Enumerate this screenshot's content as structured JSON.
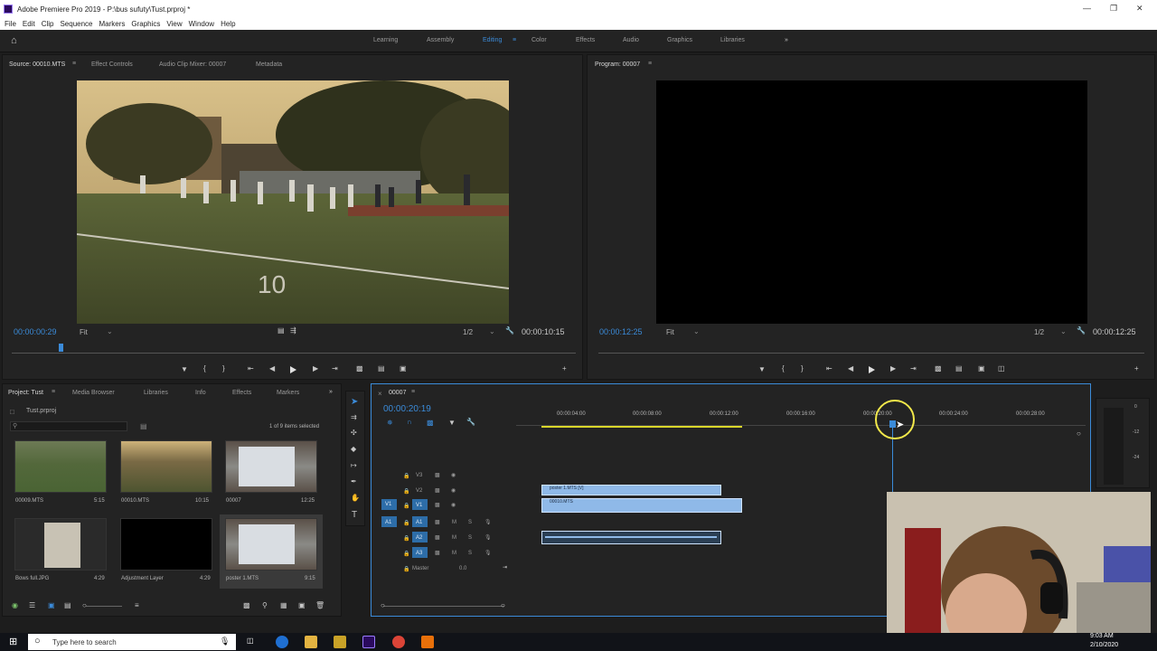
{
  "titlebar": {
    "title": "Adobe Premiere Pro 2019 - P:\\bus sufuty\\Tust.prproj *"
  },
  "menu": [
    "File",
    "Edit",
    "Clip",
    "Sequence",
    "Markers",
    "Graphics",
    "View",
    "Window",
    "Help"
  ],
  "workspaces": [
    "Learning",
    "Assembly",
    "Editing",
    "Color",
    "Effects",
    "Audio",
    "Graphics",
    "Libraries"
  ],
  "active_workspace": "Editing",
  "source": {
    "tabs": [
      "Source: 00010.MTS",
      "Effect Controls",
      "Audio Clip Mixer: 00007",
      "Metadata"
    ],
    "timecode": "00:00:00:29",
    "fit": "Fit",
    "resolution": "1/2",
    "duration": "00:00:10:15"
  },
  "program": {
    "tab": "Program: 00007",
    "timecode": "00:00:12:25",
    "fit": "Fit",
    "resolution": "1/2",
    "duration": "00:00:12:25"
  },
  "project": {
    "tabs": [
      "Project: Tust",
      "Media Browser",
      "Libraries",
      "Info",
      "Effects",
      "Markers"
    ],
    "file": "Tust.prproj",
    "selection": "1 of 9 items selected",
    "items": [
      {
        "name": "00009.MTS",
        "duration": "5:15"
      },
      {
        "name": "00010.MTS",
        "duration": "10:15"
      },
      {
        "name": "00007",
        "duration": "12:25"
      },
      {
        "name": "Bows full.JPG",
        "duration": "4:29"
      },
      {
        "name": "Adjustment Layer",
        "duration": "4:29"
      },
      {
        "name": "poster 1.MTS",
        "duration": "9:15"
      }
    ]
  },
  "timeline": {
    "tab": "00007",
    "timecode": "00:00:20:19",
    "ruler": [
      "00:00:04:00",
      "00:00:08:00",
      "00:00:12:00",
      "00:00:16:00",
      "00:00:20:00",
      "00:00:24:00",
      "00:00:28:00"
    ],
    "video_tracks": [
      "V3",
      "V2",
      "V1"
    ],
    "audio_tracks": [
      "A1",
      "A2",
      "A3"
    ],
    "source_v": "V1",
    "source_a": "A1",
    "master_label": "Master",
    "master_value": "0.0",
    "clips": [
      {
        "label": "poster 1.MTS [V]",
        "track": "V2"
      },
      {
        "label": "00010.MTS",
        "track": "V1"
      },
      {
        "label": "",
        "track": "A2"
      }
    ]
  },
  "taskbar": {
    "search_placeholder": "Type here to search",
    "time": "9:03 AM",
    "date": "2/10/2020"
  },
  "colors": {
    "accent": "#3b8bd9",
    "clip": "#8fb9e8",
    "panel": "#232323"
  }
}
